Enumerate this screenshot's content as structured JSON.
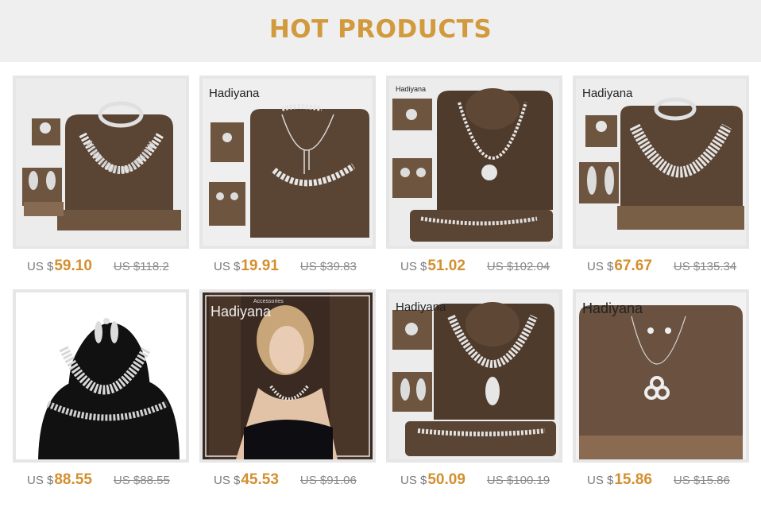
{
  "header": {
    "title": "HOT PRODUCTS"
  },
  "colors": {
    "accent": "#d19a3c",
    "price": "#d38f2e",
    "header_bg": "#efefef"
  },
  "products": [
    {
      "brand": "",
      "currency": "US $",
      "price": "59.10",
      "original_price": "US $118.2",
      "scene": "brown-stand-bib-set"
    },
    {
      "brand": "Hadiyana",
      "currency": "US $",
      "price": "19.91",
      "original_price": "US $39.83",
      "scene": "brown-stand-leaf-set"
    },
    {
      "brand": "Hadiyana",
      "currency": "US $",
      "price": "51.02",
      "original_price": "US $102.04",
      "scene": "brown-stand-pendant-set"
    },
    {
      "brand": "Hadiyana",
      "currency": "US $",
      "price": "67.67",
      "original_price": "US $135.34",
      "scene": "brown-stand-bib-set"
    },
    {
      "brand": "",
      "currency": "US $",
      "price": "88.55",
      "original_price": "US $88.55",
      "scene": "black-bust-set"
    },
    {
      "brand": "Hadiyana",
      "brand_sub": "Accessories",
      "currency": "US $",
      "price": "45.53",
      "original_price": "US $91.06",
      "scene": "model-photo"
    },
    {
      "brand": "Hadiyana",
      "currency": "US $",
      "price": "50.09",
      "original_price": "US $100.19",
      "scene": "brown-stand-drop-set"
    },
    {
      "brand": "Hadiyana",
      "currency": "US $",
      "price": "15.86",
      "original_price": "US $15.86",
      "scene": "brown-board-circle-pendant"
    }
  ]
}
